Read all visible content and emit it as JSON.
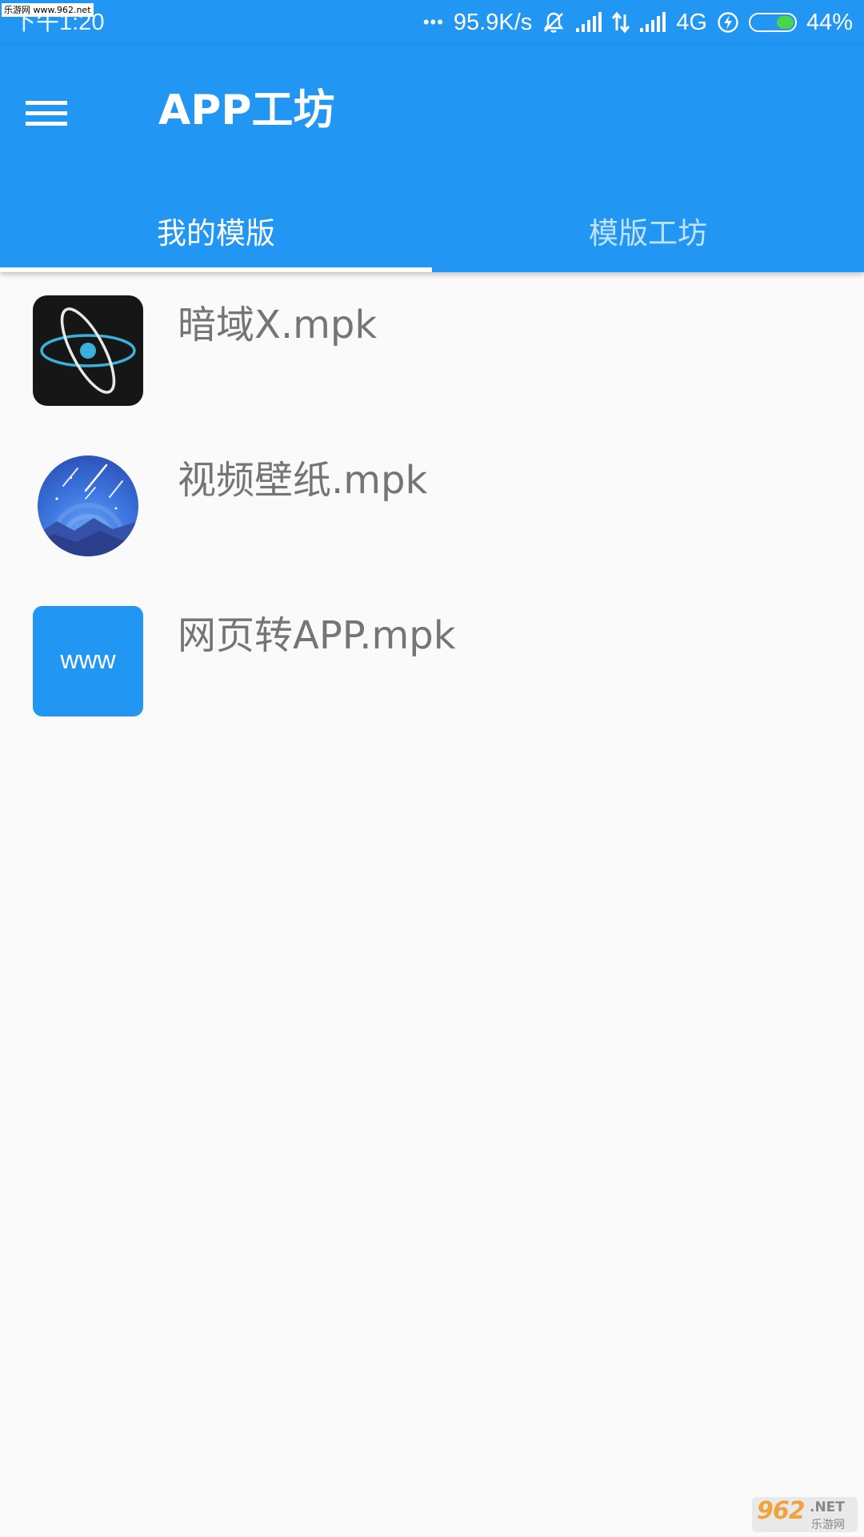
{
  "watermark_top_left": "乐游网 www.962.net",
  "status_bar": {
    "time": "下午1:20",
    "more": "•••",
    "net_speed": "95.9K/s",
    "network_type": "4G",
    "battery": "44%",
    "battery_level": 0.44,
    "battery_fill_color": "#4cd34a",
    "icons": [
      "more-dots-icon",
      "mute-bell-icon",
      "signal-icon",
      "data-arrows-icon",
      "signal-icon",
      "charging-icon",
      "battery-icon"
    ]
  },
  "app_bar": {
    "menu_icon": "hamburger-menu-icon",
    "title": "APP工坊",
    "color": "#2196f3"
  },
  "tabs": [
    {
      "label": "我的模版",
      "active": true
    },
    {
      "label": "模版工坊",
      "active": false
    }
  ],
  "templates": [
    {
      "name": "暗域X.mpk",
      "icon": "orbit-atom-icon"
    },
    {
      "name": "视频壁纸.mpk",
      "icon": "meteor-night-sky-icon"
    },
    {
      "name": "网页转APP.mpk",
      "icon": "www-icon",
      "icon_text": "www"
    }
  ],
  "watermark_bottom_right": {
    "logo": "962",
    "net": ".NET",
    "sub": "乐游网"
  }
}
